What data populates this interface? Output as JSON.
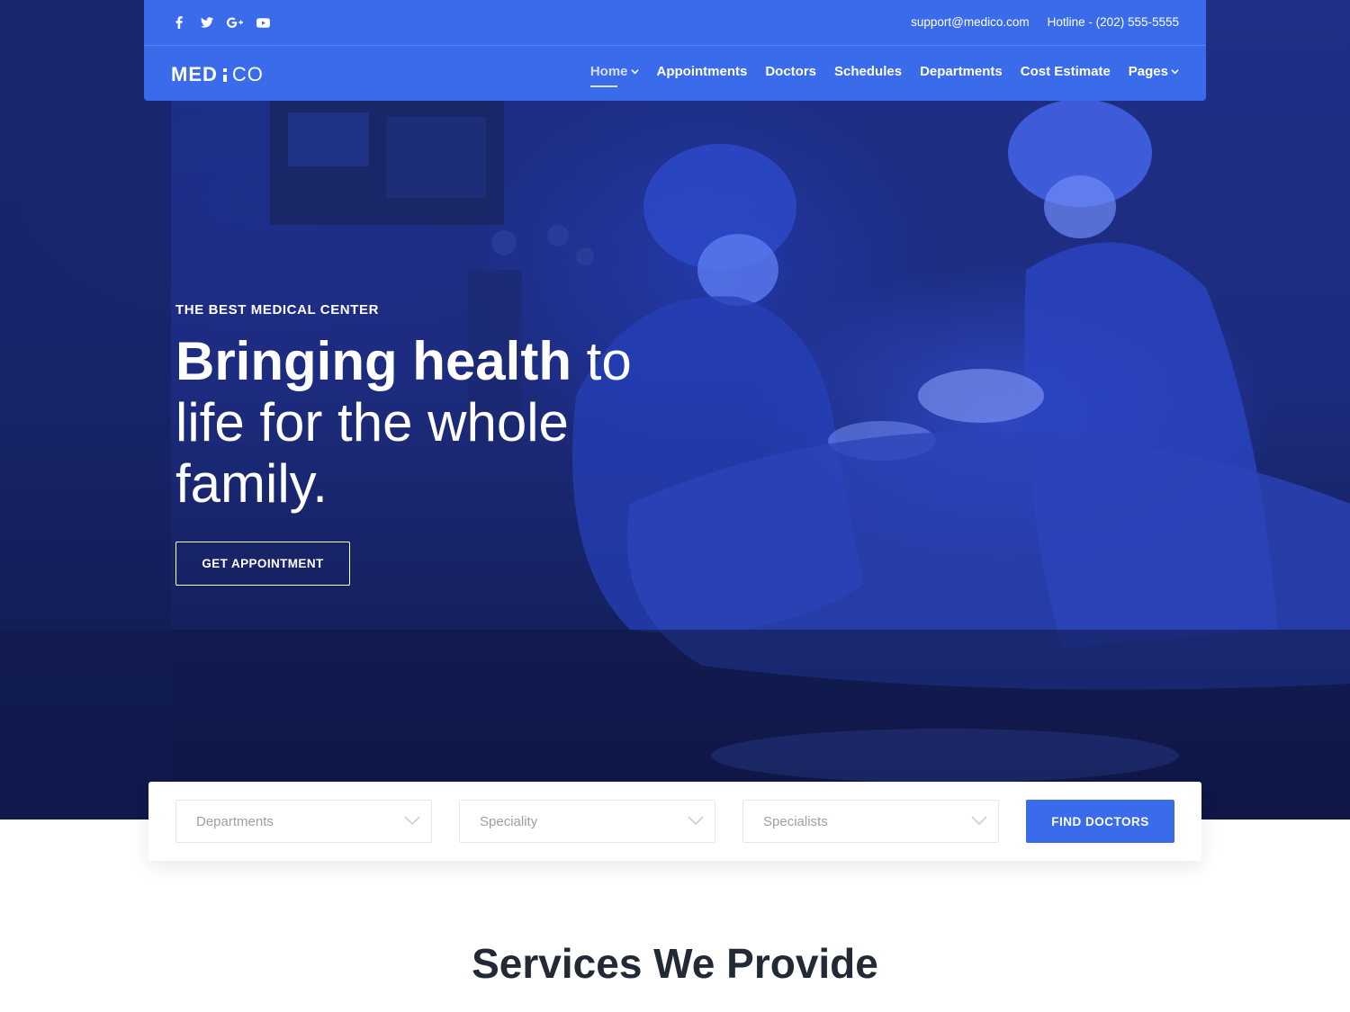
{
  "topbar": {
    "socials": [
      {
        "icon": "facebook-icon"
      },
      {
        "icon": "twitter-icon"
      },
      {
        "icon": "google-plus-icon"
      },
      {
        "icon": "youtube-icon"
      }
    ],
    "email": "support@medico.com",
    "hotline": "Hotline - (202) 555-5555"
  },
  "logo": {
    "part1": "MED",
    "part2": "CO"
  },
  "nav": {
    "items": [
      {
        "label": "Home",
        "dropdown": true,
        "active": true
      },
      {
        "label": "Appointments"
      },
      {
        "label": "Doctors"
      },
      {
        "label": "Schedules"
      },
      {
        "label": "Departments"
      },
      {
        "label": "Cost Estimate"
      },
      {
        "label": "Pages",
        "dropdown": true
      }
    ]
  },
  "hero": {
    "eyebrow": "THE BEST MEDICAL CENTER",
    "headline_bold": "Bringing health",
    "headline_rest": " to life for the whole family.",
    "cta": "GET APPOINTMENT"
  },
  "finder": {
    "departments_placeholder": "Departments",
    "speciality_placeholder": "Speciality",
    "specialists_placeholder": "Specialists",
    "button": "FIND DOCTORS"
  },
  "services": {
    "title": "Services We Provide"
  },
  "colors": {
    "accent": "#3a6bea",
    "hero_overlay": "#1f2f85",
    "heading": "#222a36"
  }
}
